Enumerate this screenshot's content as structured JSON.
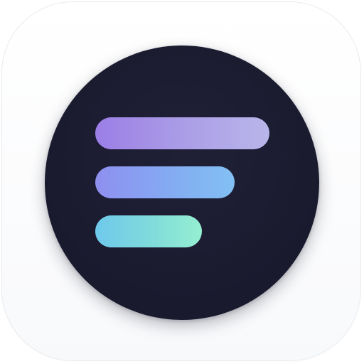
{
  "icon": {
    "name": "menu-lines-app-icon",
    "colors": {
      "background": "#ffffff",
      "disc": "#1c1c31",
      "bar_top": [
        "#9b7ee6",
        "#b9b6ea"
      ],
      "bar_middle": [
        "#8f8ff0",
        "#82c0f3"
      ],
      "bar_bottom": [
        "#6fc9ec",
        "#95efd0"
      ]
    }
  }
}
